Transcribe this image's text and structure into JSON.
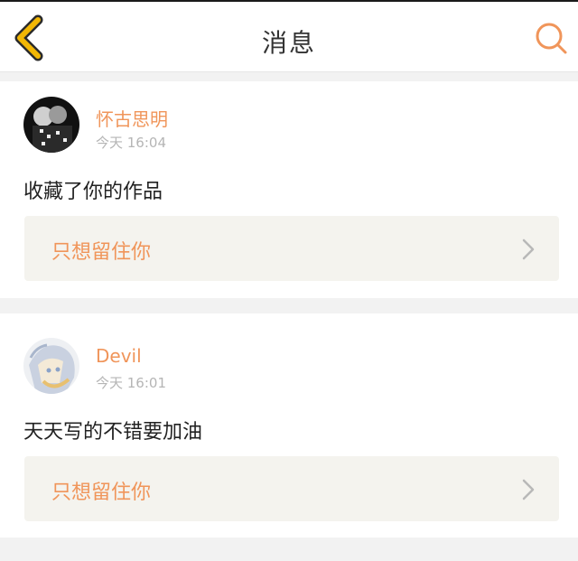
{
  "header": {
    "title": "消息",
    "back_icon": "chevron-left-icon",
    "search_icon": "search-icon"
  },
  "colors": {
    "accent": "#f0955a",
    "back_stroke": "#f2b705",
    "work_bg": "#f4f3ee"
  },
  "messages": [
    {
      "username": "怀古思明",
      "time": "今天 16:04",
      "text": "收藏了你的作品",
      "work_title": "只想留住你",
      "chevron_icon": "chevron-right-icon"
    },
    {
      "username": "Devil",
      "time": "今天 16:01",
      "text": "天天写的不错要加油",
      "work_title": "只想留住你",
      "chevron_icon": "chevron-right-icon"
    }
  ]
}
